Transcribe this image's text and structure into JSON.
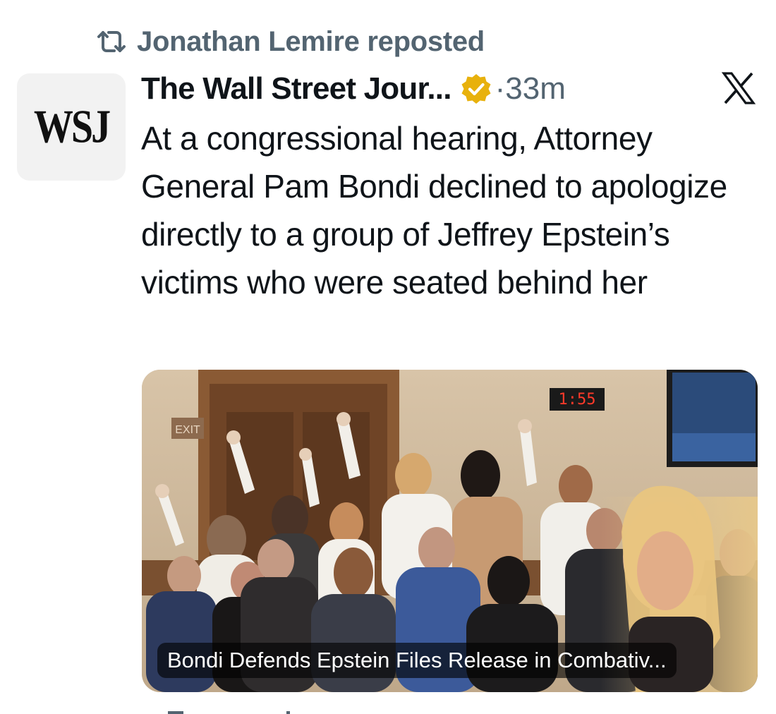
{
  "repost": {
    "icon": "repost-icon",
    "text": "Jonathan Lemire reposted"
  },
  "tweet": {
    "avatar_text": "WSJ",
    "author_name": "The Wall Street Jour...",
    "verified_icon": "gold-verified-badge-icon",
    "separator": "·",
    "timestamp": "33m",
    "platform_icon": "x-logo-icon",
    "text": "At a congressional hearing, Attorney General Pam Bondi declined to apologize directly to a group of Jeffrey Epstein’s victims who were seated behind her"
  },
  "media": {
    "caption": "Bondi Defends Epstein Files Release in Combativ...",
    "exit_sign": "EXIT",
    "clock_display": "1:55"
  },
  "colors": {
    "text_primary": "#0f1419",
    "text_secondary": "#536471",
    "verified_gold": "#e8b10c",
    "avatar_bg": "#f2f2f2"
  }
}
